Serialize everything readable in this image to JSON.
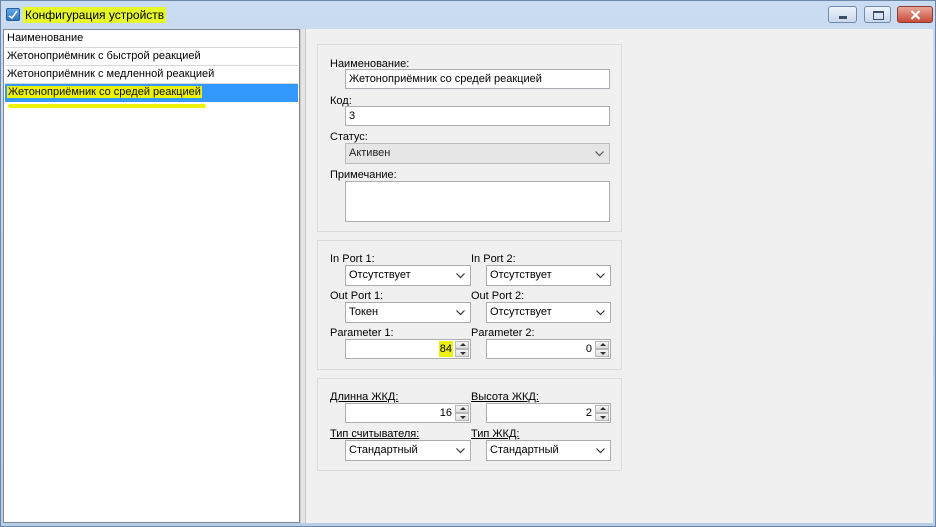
{
  "window": {
    "title": "Конфигурация устройств",
    "icon": "config-app-icon"
  },
  "list": {
    "header": "Наименование",
    "items": [
      "Жетоноприёмник с быстрой реакцией",
      "Жетоноприёмник с медленной реакцией",
      "Жетоноприёмник со средей реакцией"
    ],
    "selected_index": 2
  },
  "general": {
    "name_label": "Наименование:",
    "name_value": "Жетоноприёмник со средей реакцией",
    "code_label": "Код:",
    "code_value": "3",
    "status_label": "Статус:",
    "status_value": "Активен",
    "note_label": "Примечание:",
    "note_value": ""
  },
  "ports": {
    "in_port1_label": "In Port 1:",
    "in_port1_value": "Отсутствует",
    "in_port2_label": "In Port 2:",
    "in_port2_value": "Отсутствует",
    "out_port1_label": "Out Port 1:",
    "out_port1_value": "Токен",
    "out_port2_label": "Out Port 2:",
    "out_port2_value": "Отсутствует",
    "param1_label": "Parameter 1:",
    "param1_value": "84",
    "param2_label": "Parameter 2:",
    "param2_value": "0"
  },
  "display": {
    "lcd_length_label": "Длинна ЖКД:",
    "lcd_length_value": "16",
    "lcd_height_label": "Высота ЖКД:",
    "lcd_height_value": "2",
    "reader_type_label": "Тип считывателя:",
    "reader_type_value": "Стандартный",
    "lcd_type_label": "Тип ЖКД:",
    "lcd_type_value": "Стандартный"
  },
  "colors": {
    "highlight": "#ecf20b",
    "selection": "#3399ff"
  }
}
